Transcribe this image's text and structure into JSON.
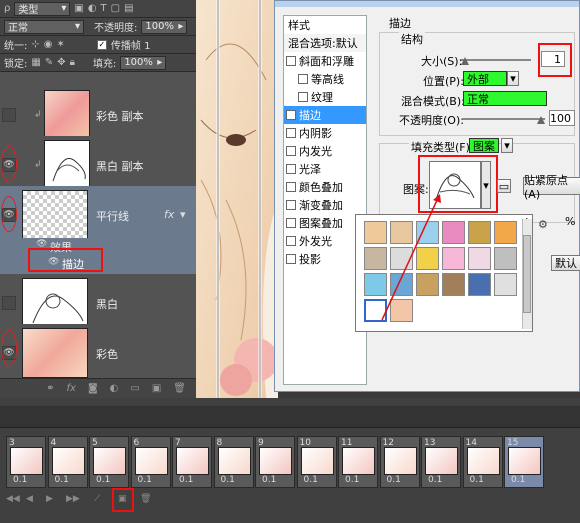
{
  "colors": {
    "accent_red": "#e01010",
    "green": "#2ef92e",
    "selection": "#3399ff"
  },
  "layers_panel": {
    "toolbar_row1": {
      "kind_label": "类型",
      "icons": [
        "image-filter-icon",
        "adjust-filter-icon",
        "text-filter-icon",
        "shape-filter-icon",
        "smart-filter-icon"
      ]
    },
    "blend_mode": "正常",
    "opacity_label": "不透明度:",
    "opacity_value": "100%",
    "unify_label": "统一:",
    "propagate_label": "传播帧 1",
    "lock_label": "锁定:",
    "fill_label": "填充:",
    "fill_value": "100%",
    "layers": [
      {
        "name": "彩色 副本",
        "visible": false
      },
      {
        "name": "黑白 副本",
        "visible": true
      },
      {
        "name": "平行线",
        "visible": true,
        "selected": true,
        "fx": "fx"
      },
      {
        "name": "黑白",
        "visible": false
      },
      {
        "name": "彩色",
        "visible": true
      }
    ],
    "effects_label": "效果",
    "stroke_effect_label": "描边"
  },
  "dialog": {
    "styles_header": "样式",
    "blend_default": "混合选项:默认",
    "styles": [
      {
        "label": "斜面和浮雕",
        "checked": false
      },
      {
        "label": "等高线",
        "checked": false,
        "indent": true
      },
      {
        "label": "纹理",
        "checked": false,
        "indent": true
      },
      {
        "label": "描边",
        "checked": true,
        "active": true
      },
      {
        "label": "内阴影",
        "checked": false
      },
      {
        "label": "内发光",
        "checked": false
      },
      {
        "label": "光泽",
        "checked": false
      },
      {
        "label": "颜色叠加",
        "checked": false
      },
      {
        "label": "渐变叠加",
        "checked": false
      },
      {
        "label": "图案叠加",
        "checked": false
      },
      {
        "label": "外发光",
        "checked": false
      },
      {
        "label": "投影",
        "checked": false
      }
    ],
    "section_title": "描边",
    "structure_title": "结构",
    "size_label": "大小(S):",
    "size_value": "1",
    "position_label": "位置(P):",
    "position_value": "外部",
    "blend_label": "混合模式(B):",
    "blend_value": "正常",
    "opacity_label": "不透明度(O):",
    "opacity_value": "100",
    "fill_type_label": "填充类型(F):",
    "fill_type_value": "图案",
    "pattern_label": "图案:",
    "snap_origin_button": "贴紧原点(A)",
    "set_default_fragment": "默认",
    "percent_fragment": "%"
  },
  "timeline": {
    "frames": [
      {
        "num": "3",
        "dur": "0.1"
      },
      {
        "num": "4",
        "dur": "0.1"
      },
      {
        "num": "5",
        "dur": "0.1"
      },
      {
        "num": "6",
        "dur": "0.1"
      },
      {
        "num": "7",
        "dur": "0.1"
      },
      {
        "num": "8",
        "dur": "0.1"
      },
      {
        "num": "9",
        "dur": "0.1"
      },
      {
        "num": "10",
        "dur": "0.1"
      },
      {
        "num": "11",
        "dur": "0.1"
      },
      {
        "num": "12",
        "dur": "0.1"
      },
      {
        "num": "13",
        "dur": "0.1"
      },
      {
        "num": "14",
        "dur": "0.1"
      },
      {
        "num": "15",
        "dur": "0.1",
        "selected": true
      }
    ]
  }
}
